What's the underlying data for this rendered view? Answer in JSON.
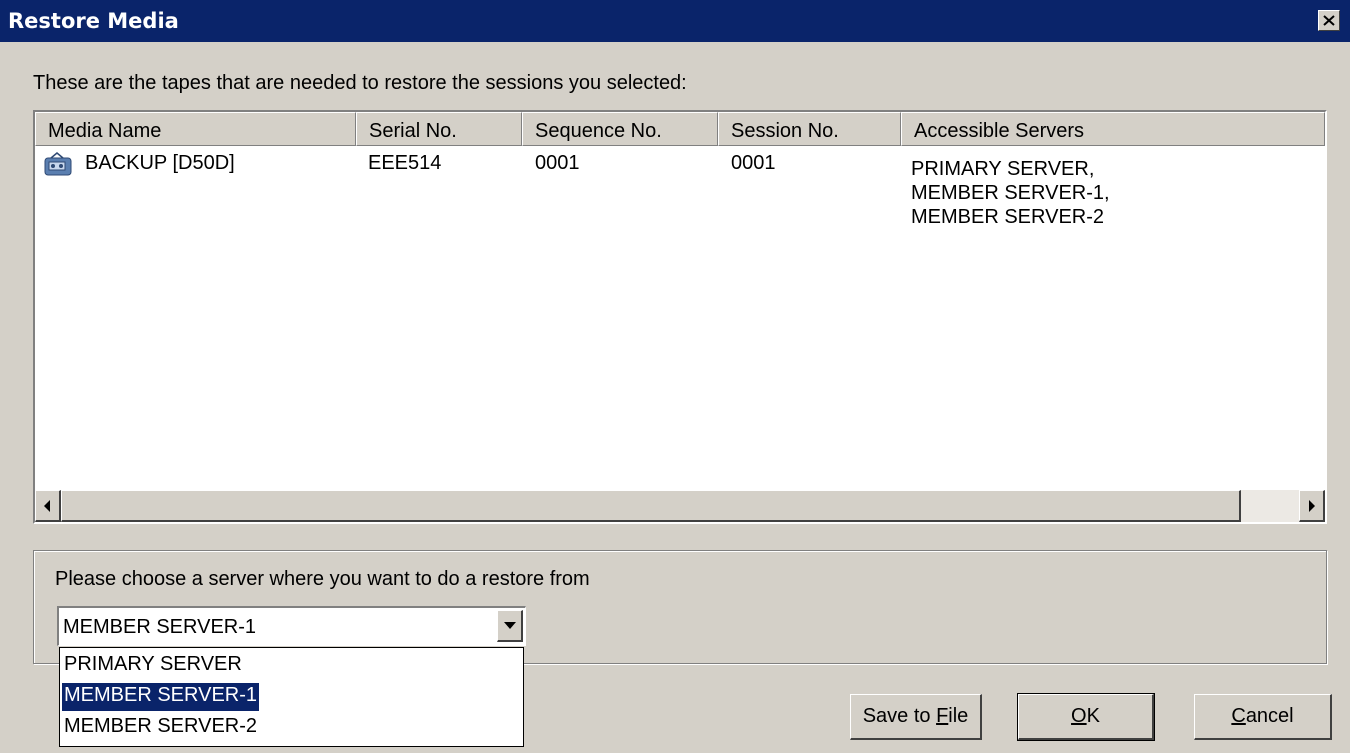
{
  "window": {
    "title": "Restore Media",
    "close_glyph": "✕"
  },
  "intro_text": "These are the tapes that are needed to restore the sessions you selected:",
  "table": {
    "columns": [
      "Media Name",
      "Serial No.",
      "Sequence No.",
      "Session No.",
      "Accessible Servers"
    ],
    "rows": [
      {
        "icon": "tape-media-icon",
        "media_name": "BACKUP [D50D]",
        "serial_no": "EEE514",
        "sequence_no": "0001",
        "session_no": "0001",
        "accessible_servers": [
          "PRIMARY SERVER,",
          "MEMBER SERVER-1,",
          "MEMBER SERVER-2"
        ]
      }
    ]
  },
  "server_choice": {
    "label": "Please choose a server where you want to do a restore from",
    "selected": "MEMBER SERVER-1",
    "options": [
      "PRIMARY SERVER",
      "MEMBER SERVER-1",
      "MEMBER SERVER-2"
    ],
    "highlighted_index": 1
  },
  "buttons": {
    "save_prefix": "Save to ",
    "save_accel": "F",
    "save_suffix": "ile",
    "ok_accel": "O",
    "ok_suffix": "K",
    "cancel_accel": "C",
    "cancel_suffix": "ancel"
  },
  "colors": {
    "titlebar": "#0a246a",
    "face": "#d4d0c8",
    "selection": "#0a246a"
  }
}
